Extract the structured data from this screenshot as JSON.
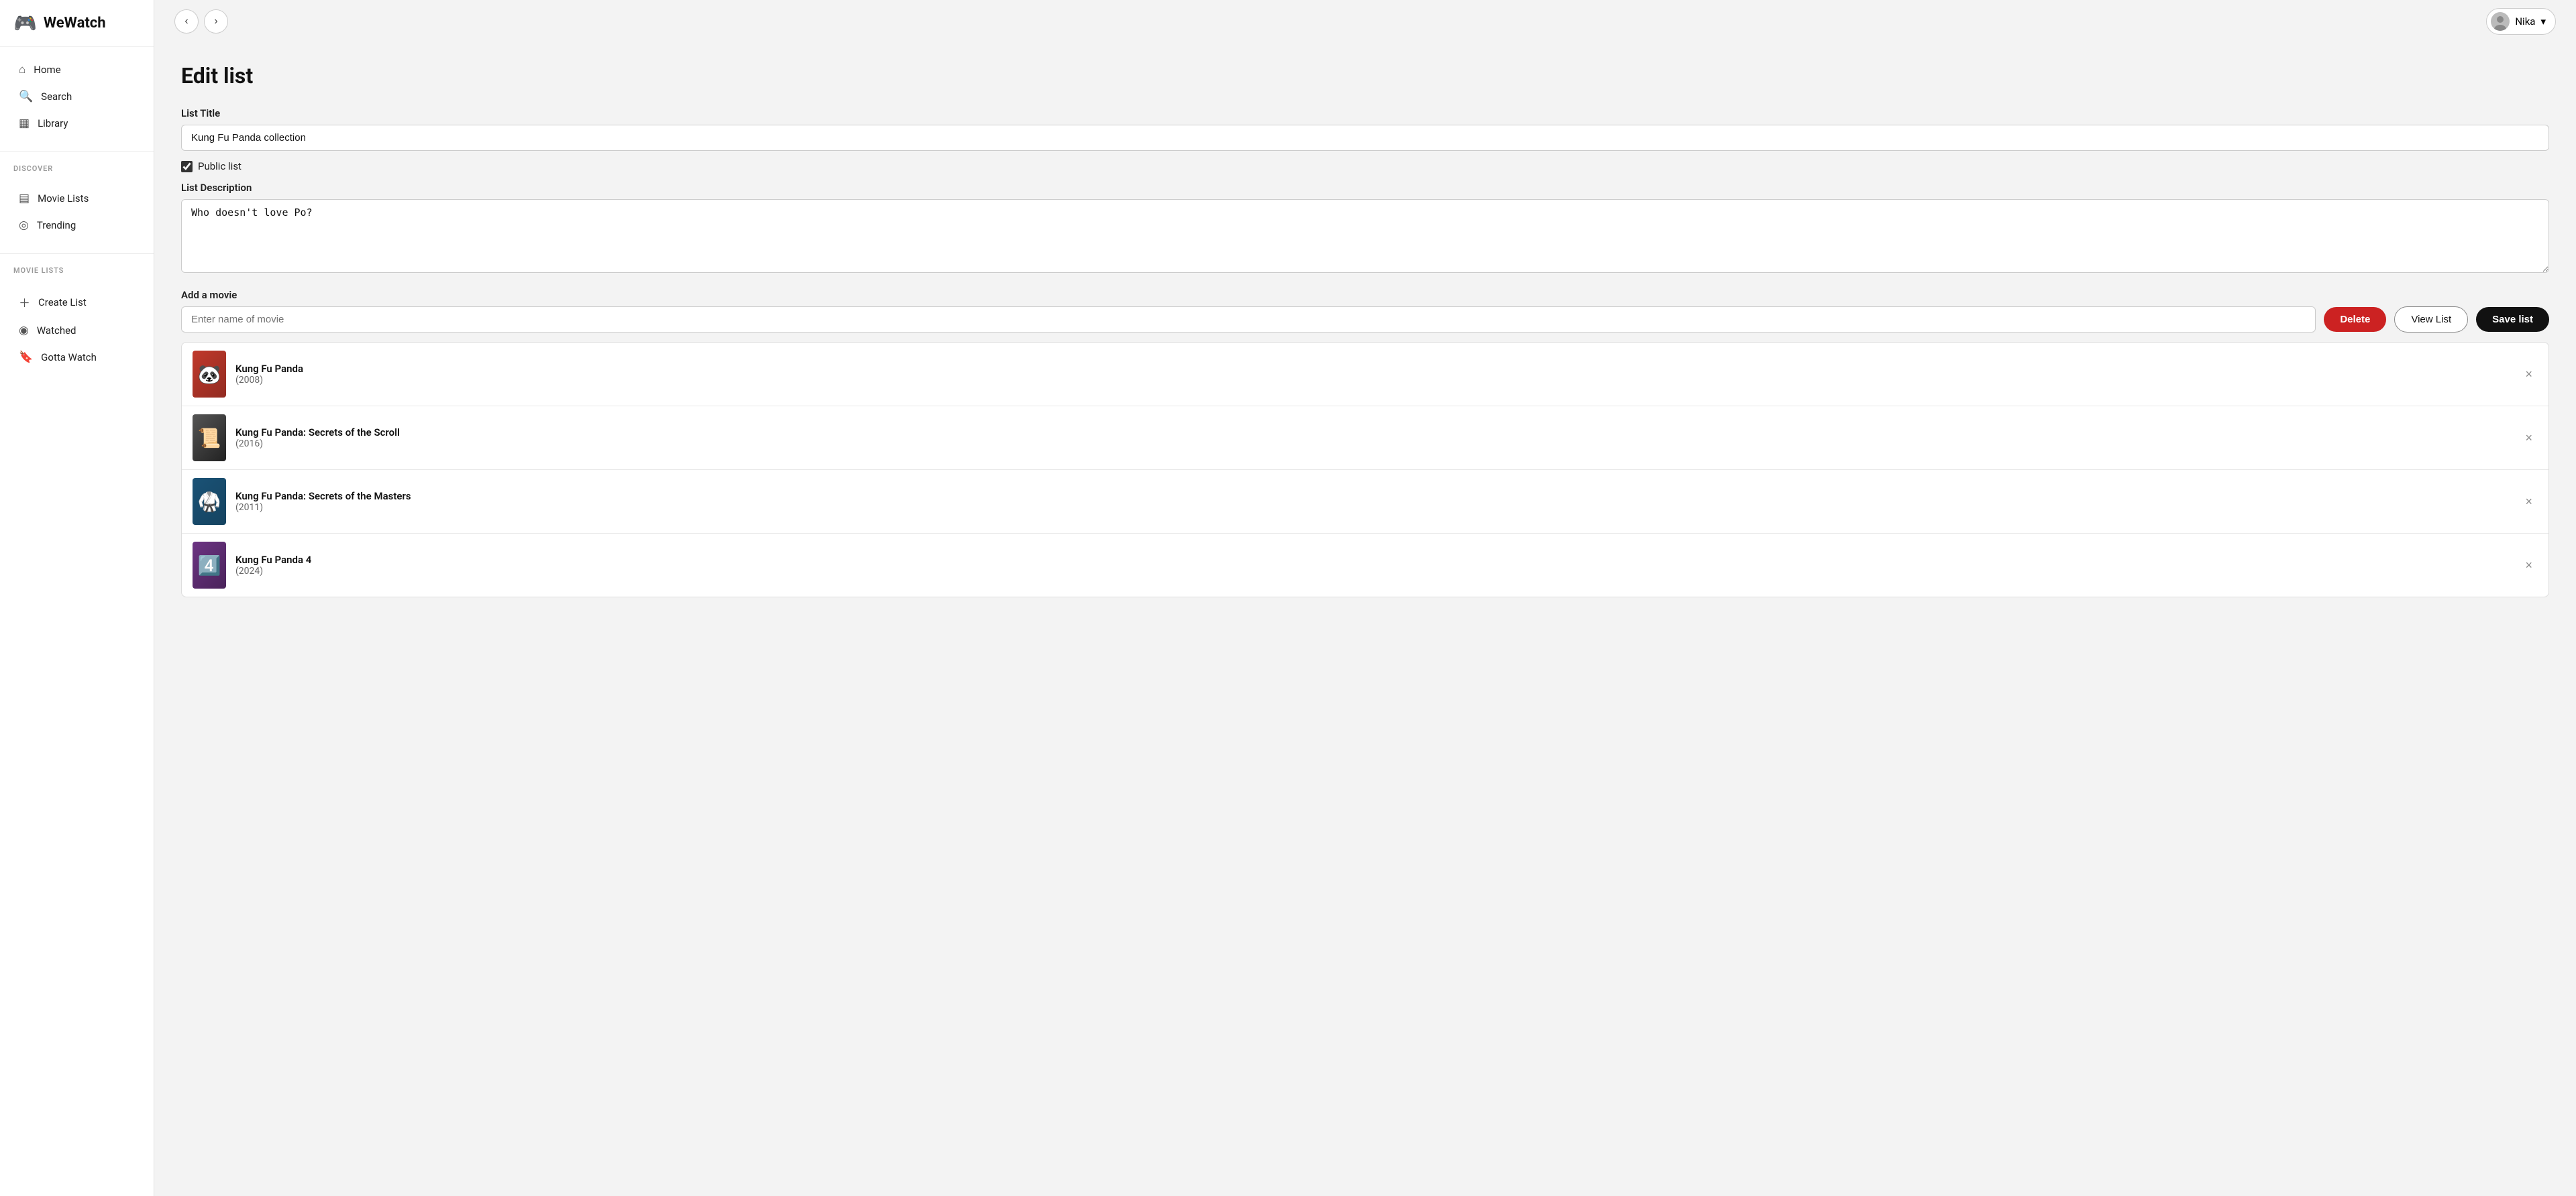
{
  "app": {
    "name": "WeWatch",
    "logo_emoji": "🎮"
  },
  "sidebar": {
    "nav_items": [
      {
        "id": "home",
        "label": "Home",
        "icon": "home"
      },
      {
        "id": "search",
        "label": "Search",
        "icon": "search"
      },
      {
        "id": "library",
        "label": "Library",
        "icon": "library"
      }
    ],
    "discover_label": "DISCOVER",
    "discover_items": [
      {
        "id": "movie-lists",
        "label": "Movie Lists",
        "icon": "list"
      },
      {
        "id": "trending",
        "label": "Trending",
        "icon": "trending"
      }
    ],
    "movie_lists_label": "MOVIE LISTS",
    "movie_lists_items": [
      {
        "id": "create-list",
        "label": "Create List",
        "icon": "plus"
      },
      {
        "id": "watched",
        "label": "Watched",
        "icon": "eye"
      },
      {
        "id": "gotta-watch",
        "label": "Gotta Watch",
        "icon": "bookmark"
      }
    ]
  },
  "topbar": {
    "back_label": "‹",
    "forward_label": "›",
    "user_name": "Nika",
    "user_chevron": "▾"
  },
  "page": {
    "title": "Edit list",
    "list_title_label": "List Title",
    "list_title_value": "Kung Fu Panda collection",
    "public_list_label": "Public list",
    "public_list_checked": true,
    "list_description_label": "List Description",
    "list_description_value": "Who doesn't love Po?",
    "add_movie_label": "Add a movie",
    "add_movie_placeholder": "Enter name of movie"
  },
  "actions": {
    "delete_label": "Delete",
    "view_list_label": "View List",
    "save_list_label": "Save list"
  },
  "movies": [
    {
      "id": "kfp1",
      "title": "Kung Fu Panda",
      "year": "(2008)",
      "poster_class": "movie-poster-kfp1",
      "emoji": "🐼"
    },
    {
      "id": "kfp-scroll",
      "title": "Kung Fu Panda: Secrets of the Scroll",
      "year": "(2016)",
      "poster_class": "movie-poster-kfp2",
      "emoji": "📜"
    },
    {
      "id": "kfp-masters",
      "title": "Kung Fu Panda: Secrets of the Masters",
      "year": "(2011)",
      "poster_class": "movie-poster-kfp3",
      "emoji": "🥋"
    },
    {
      "id": "kfp4",
      "title": "Kung Fu Panda 4",
      "year": "(2024)",
      "poster_class": "movie-poster-kfp4",
      "emoji": "4️⃣"
    }
  ]
}
